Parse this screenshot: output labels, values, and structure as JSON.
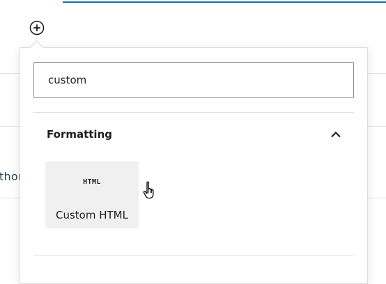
{
  "background": {
    "partial_text": "thor"
  },
  "inserter": {
    "toggle_icon": "plus-circle-icon",
    "search": {
      "value": "custom",
      "placeholder": ""
    },
    "category": {
      "title": "Formatting",
      "expanded": true,
      "toggle_icon": "chevron-up-icon"
    },
    "blocks": [
      {
        "icon": "html-icon",
        "icon_text": "HTML",
        "label": "Custom HTML",
        "hovered": true
      }
    ]
  },
  "colors": {
    "accent": "#1d6fa6",
    "tile_background": "#f0f0f0"
  }
}
